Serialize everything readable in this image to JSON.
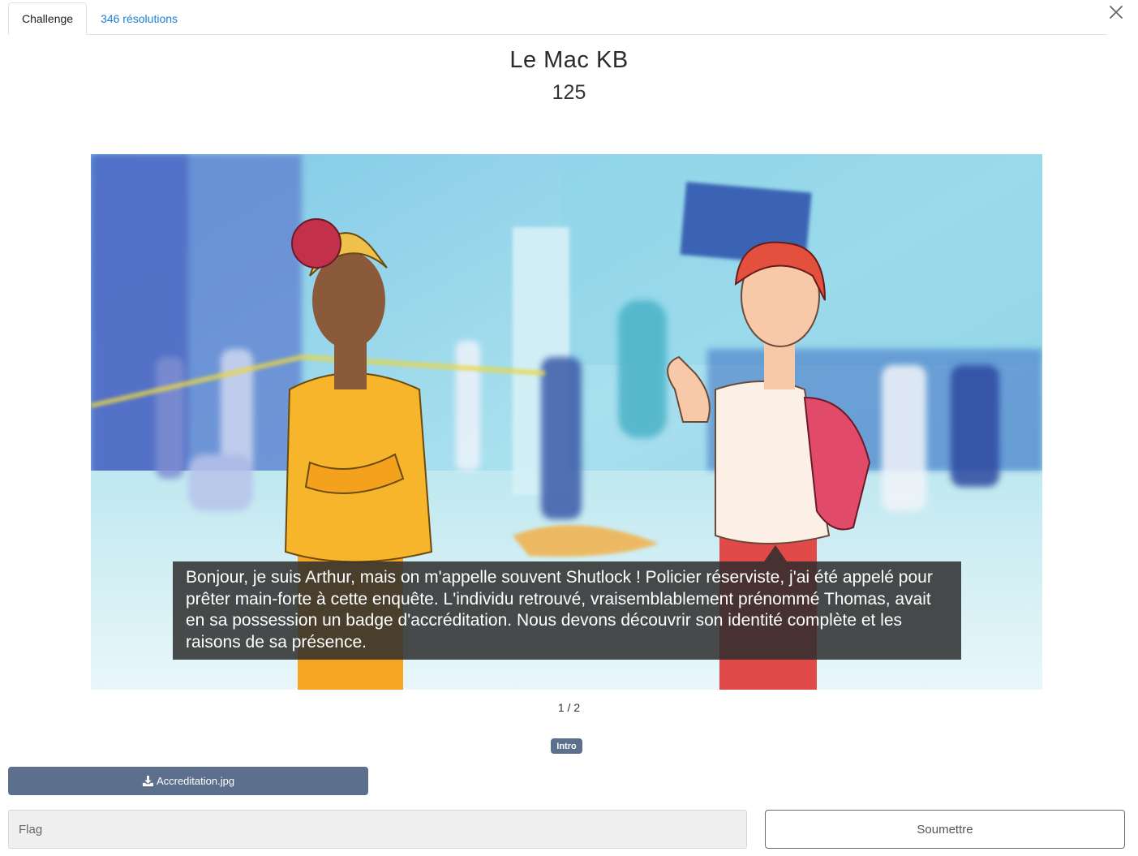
{
  "tabs": [
    {
      "label": "Challenge",
      "active": true
    },
    {
      "label": "346 résolutions",
      "active": false
    }
  ],
  "challenge": {
    "title": "Le Mac KB",
    "points": "125"
  },
  "slide": {
    "caption": "Bonjour, je suis Arthur, mais on m'appelle souvent Shutlock ! Policier réserviste, j'ai été appelé pour prêter main-forte à cette enquête. L'individu retrouvé, vraisemblablement prénommé Thomas, avait en sa possession un badge d'accréditation. Nous devons découvrir son identité complète et les raisons de sa présence.",
    "pager": "1 / 2"
  },
  "tags": [
    "Intro"
  ],
  "files": [
    {
      "name": "Accreditation.jpg",
      "icon": "download-icon"
    }
  ],
  "flag_form": {
    "placeholder": "Flag",
    "value": "",
    "submit_label": "Soumettre"
  },
  "colors": {
    "tag_bg": "#5c6f8c",
    "link": "#1c7ed6",
    "caption_bg": "#2d2d2d"
  }
}
